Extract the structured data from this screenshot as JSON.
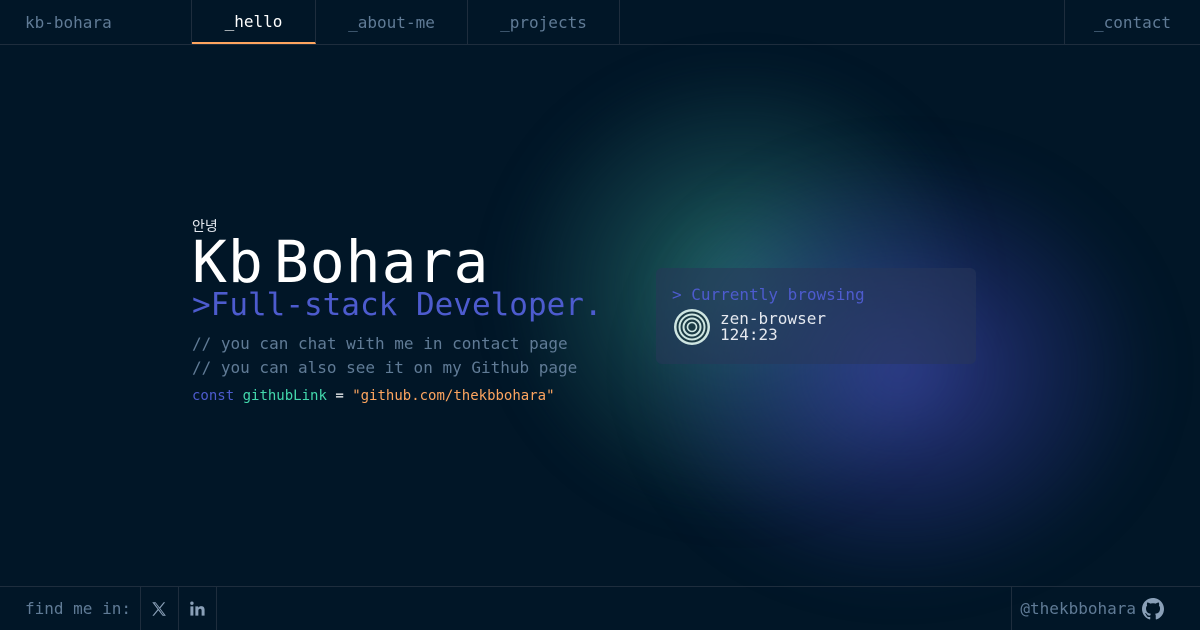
{
  "header": {
    "brand": "kb-bohara",
    "tabs": [
      {
        "label": "_hello",
        "active": true
      },
      {
        "label": "_about-me",
        "active": false
      },
      {
        "label": "_projects",
        "active": false
      }
    ],
    "contact": "_contact"
  },
  "hero": {
    "greeting": "안녕",
    "first_name": "Kb",
    "last_name": "Bohara",
    "role": ">Full-stack Developer.",
    "comments": [
      "// you can chat with me in contact page",
      "// you can also see it on my Github page"
    ],
    "code": {
      "keyword": "const",
      "variable": "githubLink",
      "operator": "=",
      "value": "\"github.com/thekbbohara\""
    }
  },
  "browsing": {
    "title": "> Currently browsing",
    "app": "zen-browser",
    "time": "124:23",
    "icon": "zen-browser-icon"
  },
  "footer": {
    "find_label": "find me in:",
    "socials": [
      {
        "name": "x-twitter",
        "icon": "x-icon"
      },
      {
        "name": "linkedin",
        "icon": "linkedin-icon"
      }
    ],
    "github_handle": "@thekbbohara",
    "github_icon": "github-icon"
  },
  "colors": {
    "background": "#011627",
    "border": "#1e2d3d",
    "muted": "#607b96",
    "accent_orange": "#fea55f",
    "accent_blue": "#4d5bce",
    "accent_green": "#43d9ad"
  }
}
